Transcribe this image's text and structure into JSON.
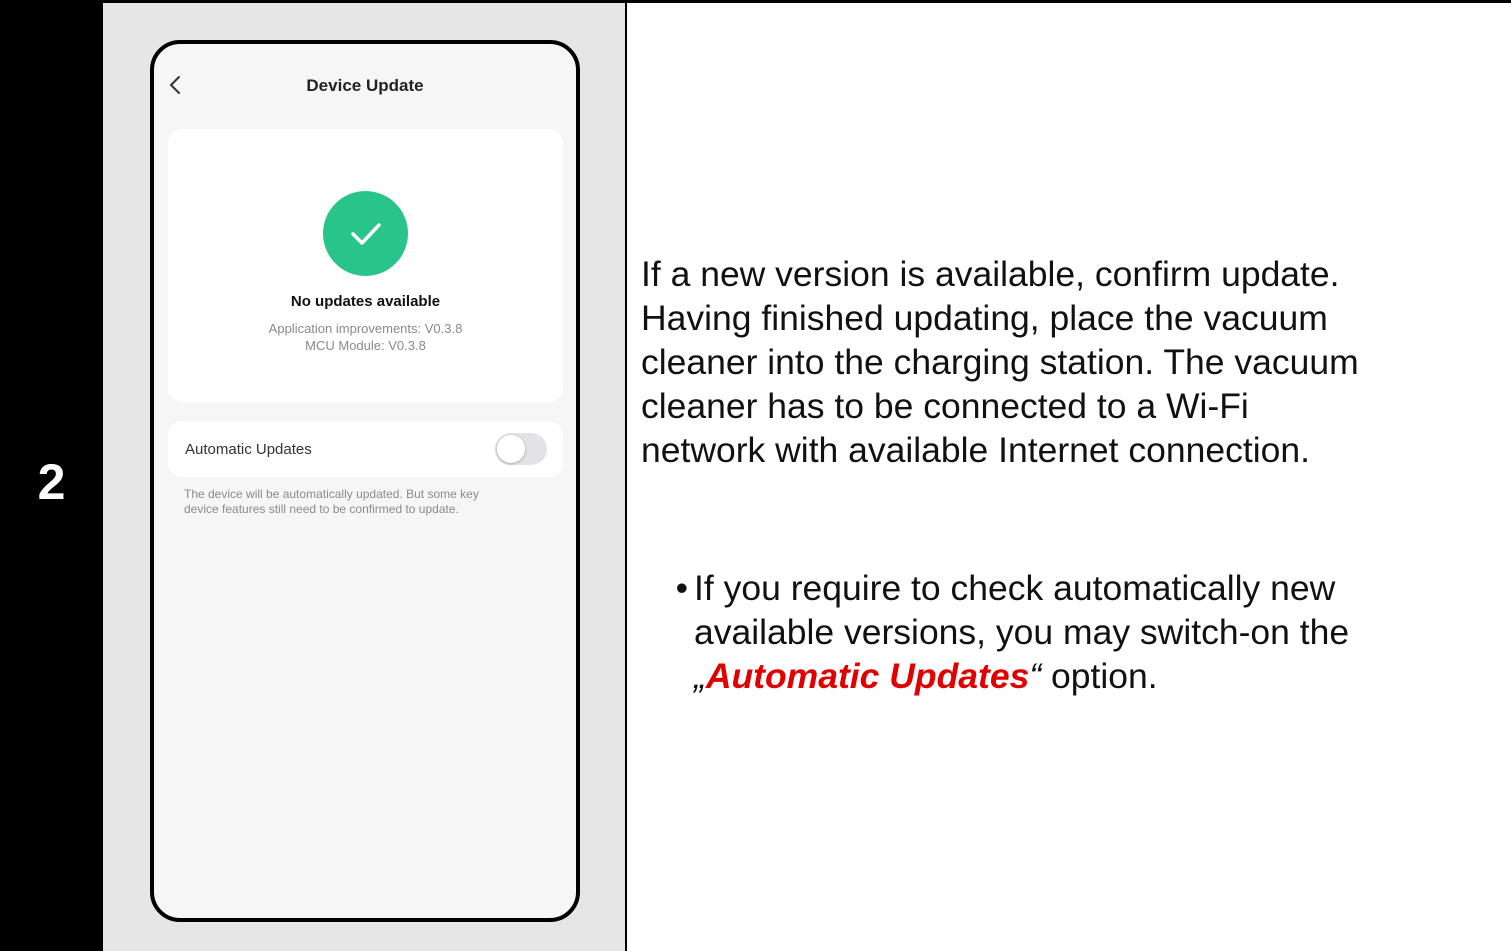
{
  "step": {
    "number": "2"
  },
  "phone": {
    "title": "Device Update",
    "status": {
      "heading": "No updates available",
      "app_version": "Application improvements: V0.3.8",
      "mcu_version": "MCU Module: V0.3.8"
    },
    "auto_updates": {
      "label": "Automatic Updates",
      "enabled": false,
      "note_line1": "The device will be automatically updated. But some key",
      "note_line2": "device features still need to be confirmed to update."
    },
    "colors": {
      "success": "#29c48a",
      "toggle_off": "#e3e3e6"
    },
    "icons": [
      "back-chevron-icon",
      "checkmark-icon"
    ]
  },
  "instructions": {
    "lines": [
      "If a new version is available, confirm update.",
      "Having finished updating, place the vacuum",
      "cleaner into the charging station. The vacuum",
      "cleaner has to be connected to a Wi-Fi",
      "network with available Internet connection."
    ],
    "bullet": {
      "marker": "•",
      "line1": "If you require to check automatically new",
      "line2": "available versions, you may switch-on the",
      "open_quote": "„",
      "highlight": "Automatic Updates",
      "close_quote": "“",
      "tail": " option."
    },
    "highlight_color": "#e00000"
  }
}
